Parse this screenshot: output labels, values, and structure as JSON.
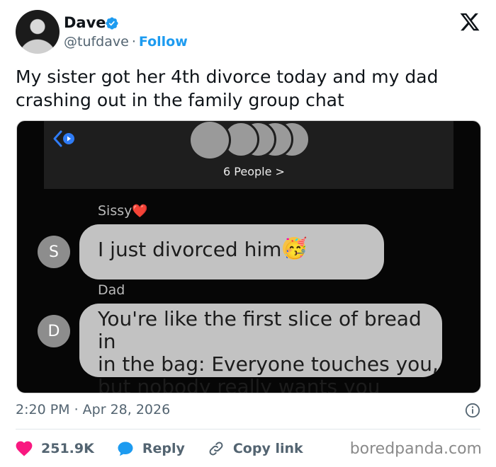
{
  "author": {
    "display_name": "Dave",
    "handle": "@tufdave",
    "separator": "·",
    "follow_label": "Follow"
  },
  "tweet": {
    "text": "My sister got her 4th divorce today and my dad crashing out in the family group chat"
  },
  "screenshot": {
    "group_label": "6 People >",
    "messages": [
      {
        "sender": "Sissy",
        "sender_emoji": "❤️",
        "avatar_letter": "S",
        "text": "I just divorced him",
        "emoji": "🥳"
      },
      {
        "sender": "Dad",
        "avatar_letter": "D",
        "text_lines": [
          "You're like the first slice of bread in",
          "in the bag: Everyone touches you,",
          "but nobody really wants you"
        ]
      }
    ]
  },
  "meta": {
    "timestamp": "2:20 PM · Apr 28, 2026"
  },
  "actions": {
    "like_count": "251.9K",
    "reply_label": "Reply",
    "copy_link_label": "Copy link"
  },
  "watermark": "boredpanda.com",
  "colors": {
    "accent": "#1d9bf0",
    "like": "#f91880",
    "muted": "#536471"
  }
}
